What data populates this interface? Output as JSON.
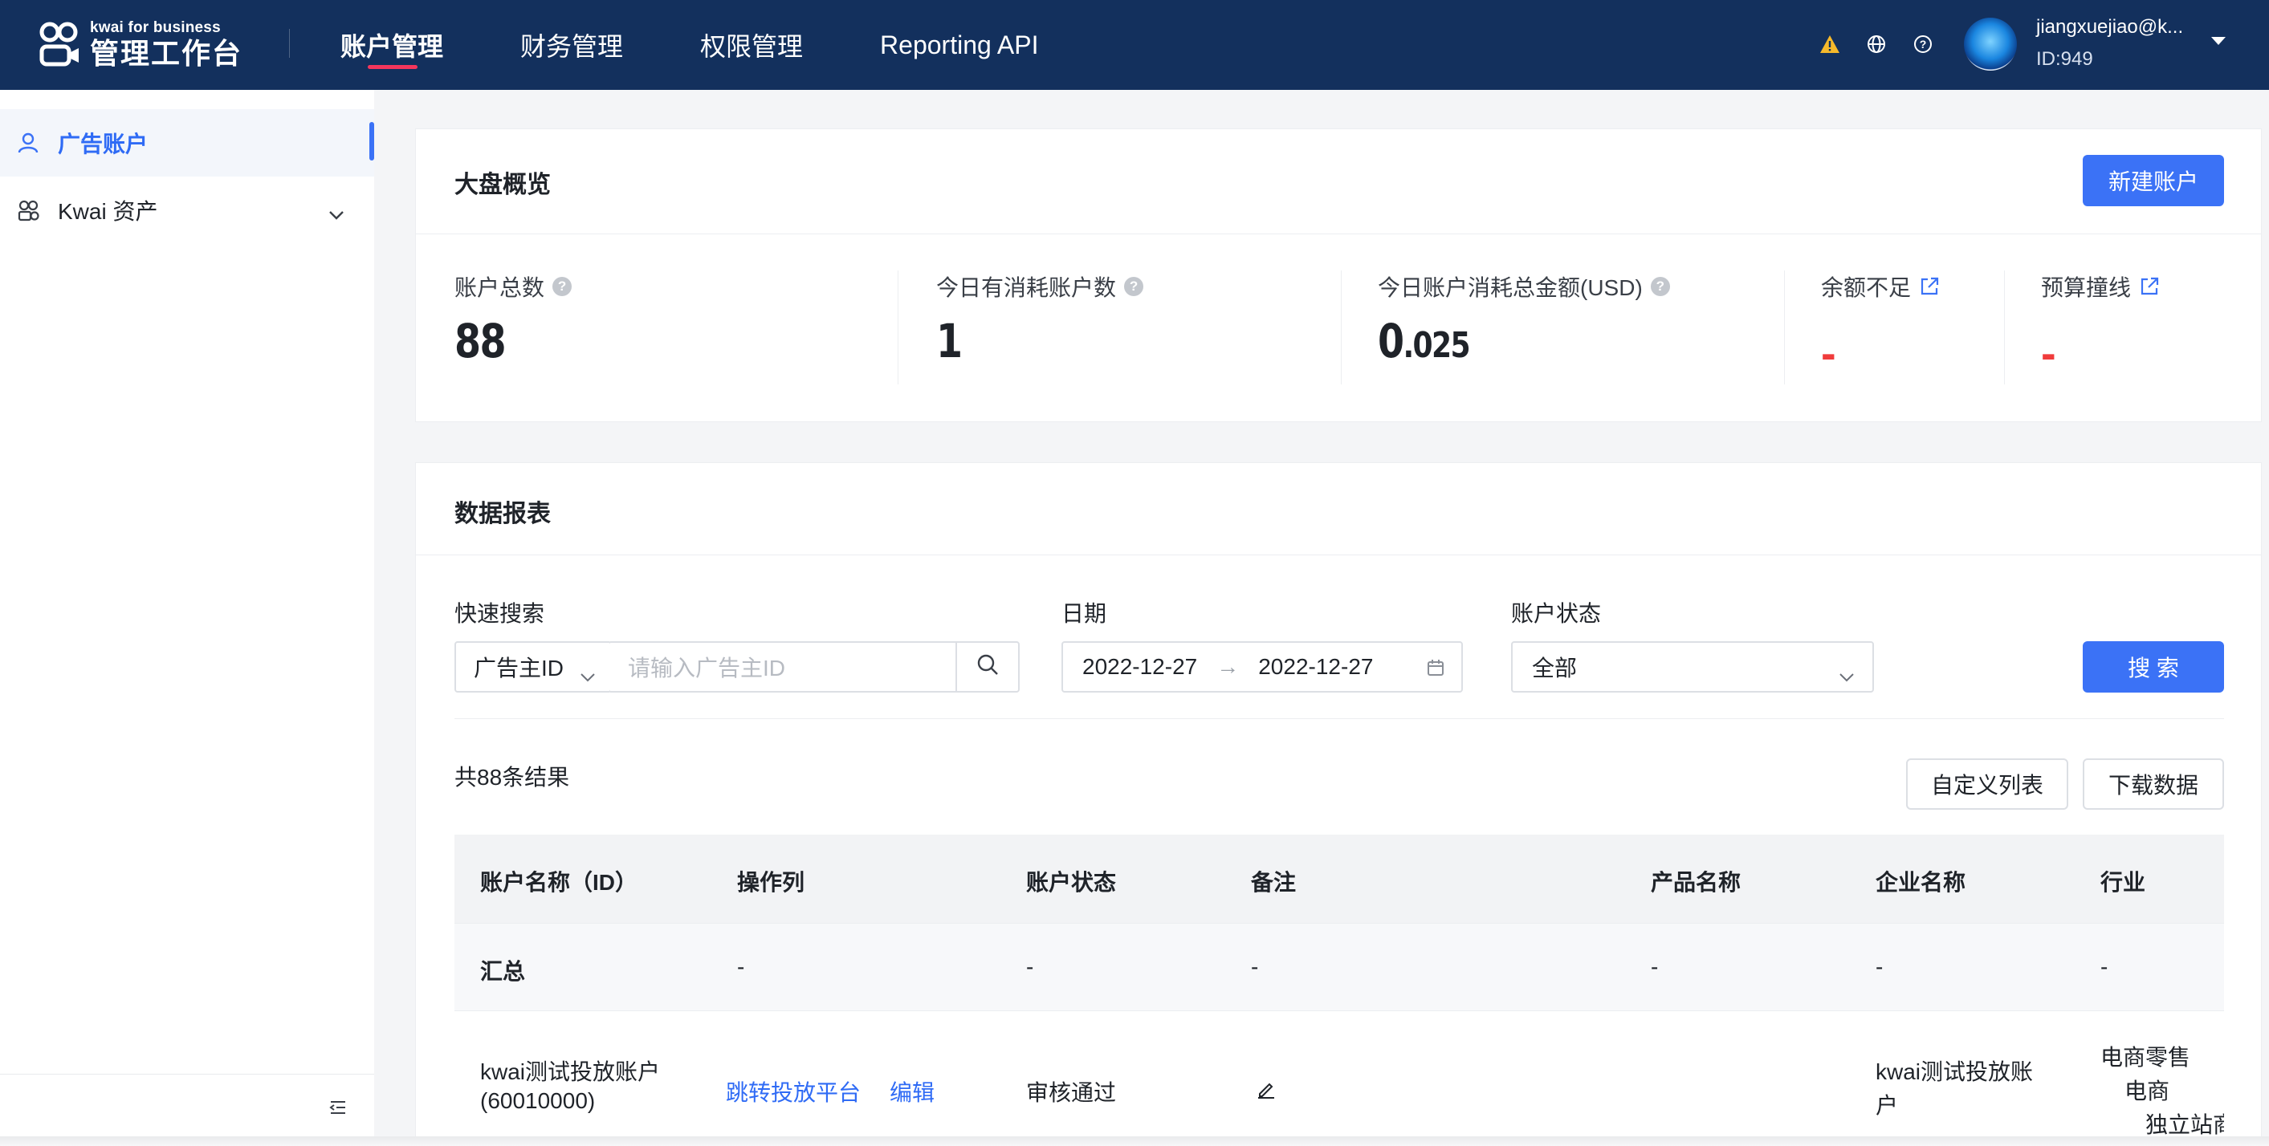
{
  "header": {
    "logo_sub": "kwai for business",
    "logo_main": "管理工作台",
    "nav": [
      "账户管理",
      "财务管理",
      "权限管理",
      "Reporting API"
    ],
    "active_nav": "账户管理",
    "icons": [
      "warning-icon",
      "globe-icon",
      "help-icon"
    ],
    "user_name": "jiangxuejiao@k...",
    "user_id": "ID:949"
  },
  "sidebar": {
    "items": [
      {
        "label": "广告账户",
        "icon": "user-icon",
        "active": true
      },
      {
        "label": "Kwai 资产",
        "icon": "assets-icon",
        "active": false
      }
    ]
  },
  "overview": {
    "title": "大盘概览",
    "new_account_button": "新建账户",
    "stats": [
      {
        "label": "账户总数",
        "value": "88"
      },
      {
        "label": "今日有消耗账户数",
        "value": "1"
      },
      {
        "label": "今日账户消耗总金额(USD)",
        "value_main": "0",
        "value_small": ".025"
      },
      {
        "label": "余额不足",
        "value": "-"
      },
      {
        "label": "预算撞线",
        "value": "-"
      }
    ]
  },
  "report": {
    "title": "数据报表",
    "quick_search_label": "快速搜索",
    "search_type": "广告主ID",
    "search_placeholder": "请输入广告主ID",
    "date_label": "日期",
    "date_start": "2022-12-27",
    "date_end": "2022-12-27",
    "date_arrow": "→",
    "status_label": "账户状态",
    "status_value": "全部",
    "search_button": "搜 索",
    "result_count": "共88条结果",
    "custom_columns_button": "自定义列表",
    "download_button": "下载数据",
    "columns": [
      "账户名称（ID）",
      "操作列",
      "账户状态",
      "备注",
      "产品名称",
      "企业名称",
      "行业"
    ],
    "summary_row": {
      "name": "汇总",
      "action": "-",
      "status": "-",
      "note": "-",
      "product": "-",
      "company": "-",
      "industry": "-"
    },
    "rows": [
      {
        "name_line1": "kwai测试投放账户",
        "name_line2": "(60010000)",
        "action_jump": "跳转投放平台",
        "action_edit": "编辑",
        "status": "审核通过",
        "company_line1": "kwai测试投放账",
        "company_line2": "户",
        "industry_line1": "电商零售",
        "industry_line2": "电商",
        "industry_line3": "独立站商"
      }
    ]
  }
}
